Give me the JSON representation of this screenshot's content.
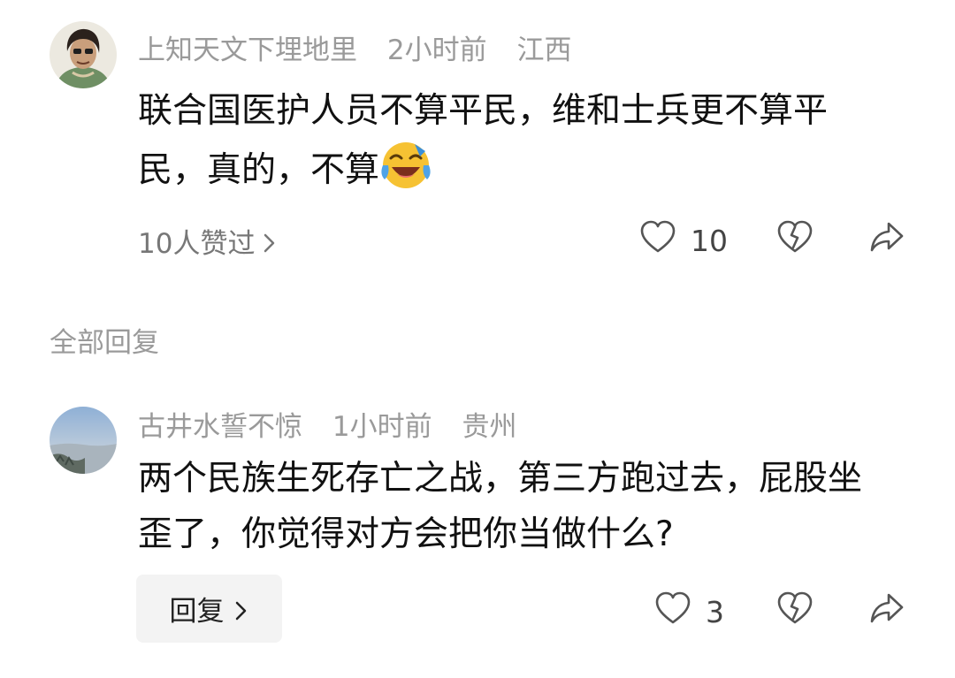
{
  "comments": [
    {
      "author": "上知天文下埋地里",
      "time": "2小时前",
      "location": "江西",
      "text": "联合国医护人员不算平民，维和士兵更不算平民，真的，不算",
      "emoji": "laughing-crying-emoji",
      "likes_link": "10人赞过",
      "like_count": "10"
    },
    {
      "author": "古井水誓不惊",
      "time": "1小时前",
      "location": "贵州",
      "text": "两个民族生死存亡之战，第三方跑过去，屁股坐歪了，你觉得对方会把你当做什么?",
      "reply_label": "回复",
      "like_count": "3"
    }
  ],
  "replies_section": {
    "label": "全部回复"
  },
  "icons": {
    "like": "heart-outline-icon",
    "dislike": "broken-heart-icon",
    "share": "share-arrow-icon",
    "chevron": "chevron-right-icon"
  }
}
